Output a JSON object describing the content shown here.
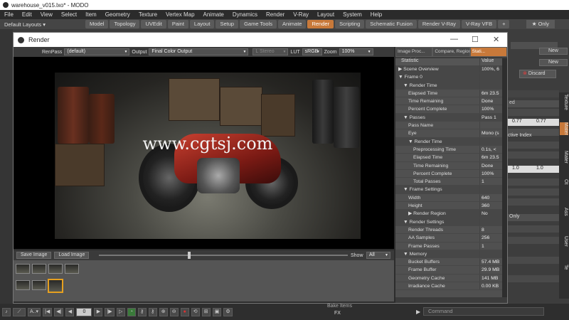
{
  "window": {
    "title": "warehouse_v015.lxo* - MODO"
  },
  "menu": [
    "File",
    "Edit",
    "View",
    "Select",
    "Item",
    "Geometry",
    "Texture",
    "Vertex Map",
    "Animate",
    "Dynamics",
    "Render",
    "V-Ray",
    "Layout",
    "System",
    "Help"
  ],
  "toolbar": {
    "layout_label": "Default Layouts ▾",
    "only_label": "★ Only"
  },
  "tabs": [
    "Model",
    "Topology",
    "UVEdit",
    "Paint",
    "Layout",
    "Setup",
    "Game Tools",
    "Animate",
    "Render",
    "Scripting",
    "Schematic Fusion",
    "Render V-Ray",
    "V-Ray VFB",
    "+"
  ],
  "active_tab": "Render",
  "render_window": {
    "title": "Render",
    "render_pass_label": "RenPass",
    "render_pass_value": "(default)",
    "output_label": "Output",
    "output_value": "Final Color Output",
    "stereo_label": "L  Stereo",
    "lut_label": "LUT",
    "lut_value": "sRGB",
    "zoom_label": "Zoom",
    "zoom_value": "100%",
    "watermark": "www.cgtsj.com",
    "save_image": "Save Image",
    "load_image": "Load Image",
    "show_label": "Show",
    "show_value": "All"
  },
  "stat_panel": {
    "tabs": [
      "Image Proc...",
      "Compare, Region, ...",
      "Stati..."
    ],
    "col_statistic": "Statistic",
    "col_value": "Value",
    "rows": [
      {
        "k": "▶ Scene Overview",
        "v": "100%, 6",
        "indent": 0
      },
      {
        "k": "▼ Frame 0",
        "v": "",
        "indent": 0
      },
      {
        "k": "▼ Render Time",
        "v": "",
        "indent": 1
      },
      {
        "k": "Elapsed Time",
        "v": "6m 23.5",
        "indent": 2
      },
      {
        "k": "Time Remaining",
        "v": "Done",
        "indent": 2
      },
      {
        "k": "Percent Complete",
        "v": "100%",
        "indent": 2
      },
      {
        "k": "▼ Passes",
        "v": "Pass 1",
        "indent": 1
      },
      {
        "k": "Pass Name",
        "v": "",
        "indent": 2
      },
      {
        "k": "Eye",
        "v": "Mono (s",
        "indent": 2
      },
      {
        "k": "▼ Render Time",
        "v": "",
        "indent": 2
      },
      {
        "k": "Preprocessing Time",
        "v": "0.1s, <",
        "indent": 3
      },
      {
        "k": "Elapsed Time",
        "v": "6m 23.5",
        "indent": 3
      },
      {
        "k": "Time Remaining",
        "v": "Done",
        "indent": 3
      },
      {
        "k": "Percent Complete",
        "v": "100%",
        "indent": 3
      },
      {
        "k": "Total Passes",
        "v": "1",
        "indent": 3
      },
      {
        "k": "▼ Frame Settings",
        "v": "",
        "indent": 1
      },
      {
        "k": "Width",
        "v": "640",
        "indent": 2
      },
      {
        "k": "Height",
        "v": "360",
        "indent": 2
      },
      {
        "k": "▶ Render Region",
        "v": "No",
        "indent": 2
      },
      {
        "k": "▼ Render Settings",
        "v": "",
        "indent": 1
      },
      {
        "k": "Render Threads",
        "v": "8",
        "indent": 2
      },
      {
        "k": "AA Samples",
        "v": "256",
        "indent": 2
      },
      {
        "k": "Frame Passes",
        "v": "1",
        "indent": 2
      },
      {
        "k": "▼ Memory",
        "v": "",
        "indent": 1
      },
      {
        "k": "Bucket Buffers",
        "v": "57.4 MB",
        "indent": 2
      },
      {
        "k": "Frame Buffer",
        "v": "29.9 MB",
        "indent": 2
      },
      {
        "k": "Geometry Cache",
        "v": "141 MB",
        "indent": 2
      },
      {
        "k": "Irradiance Cache",
        "v": "0.00 KB",
        "indent": 2
      }
    ]
  },
  "right_panel": {
    "new1": "New",
    "new2": "New",
    "discard": "Discard",
    "val1a": "0.77",
    "val1b": "0.77",
    "ctive_index": "ctive Index",
    "val2a": "1.0",
    "val2b": "1.0",
    "only": "Only",
    "side_tabs": [
      "Texture",
      "Mater",
      "Mater",
      "Ot",
      "Ass",
      "User",
      "Te"
    ]
  },
  "statusbar": {
    "frame_value": "0",
    "command_placeholder": "Command",
    "fx_label": "FX",
    "bake_label": "Bake Items"
  }
}
